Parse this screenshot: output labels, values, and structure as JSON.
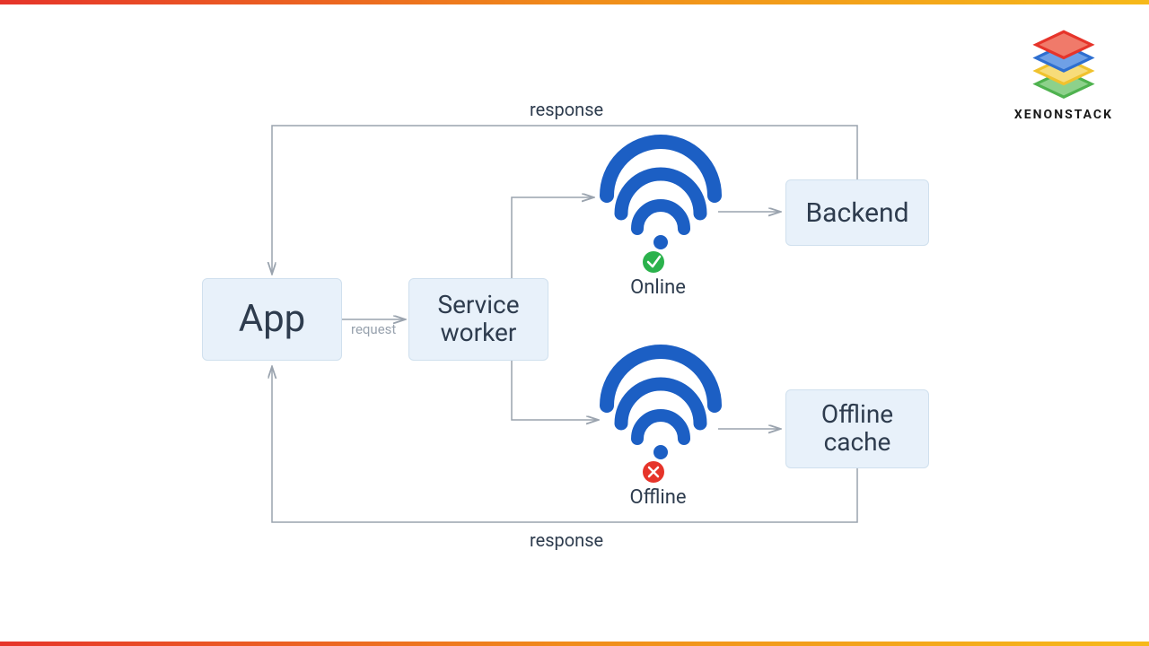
{
  "logo": {
    "text": "XENONSTACK"
  },
  "nodes": {
    "app": "App",
    "service_worker": "Service\nworker",
    "backend": "Backend",
    "offline_cache": "Offline\ncache"
  },
  "labels": {
    "request": "request",
    "response_top": "response",
    "response_bottom": "response",
    "online": "Online",
    "offline": "Offline"
  },
  "colors": {
    "node_bg": "#e8f1fa",
    "arrow": "#9aa3ae",
    "wifi": "#1c5fc4",
    "ok": "#2bb24c",
    "err": "#e6342a",
    "text": "#2e3c4e"
  }
}
